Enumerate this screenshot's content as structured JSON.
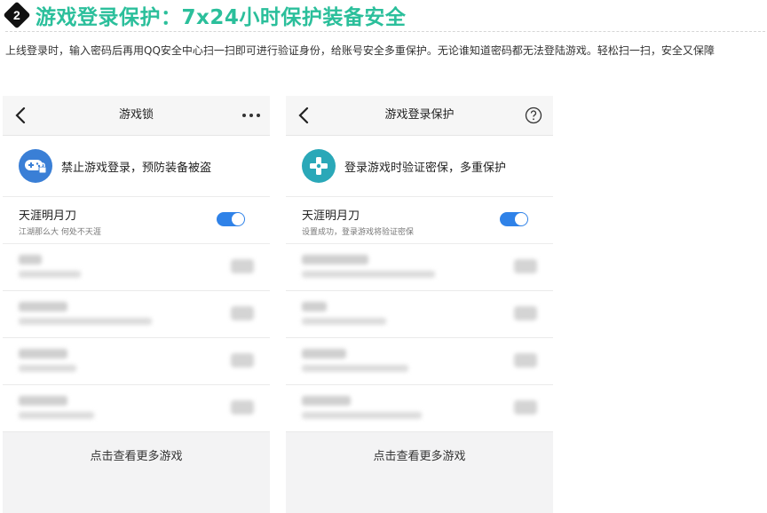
{
  "header": {
    "number": "2",
    "title": "游戏登录保护：7x24小时保护装备安全",
    "description": "上线登录时，输入密码后再用QQ安全中心扫一扫即可进行验证身份，给账号安全多重保护。无论谁知道密码都无法登陆游戏。轻松扫一扫，安全又保障"
  },
  "phones": [
    {
      "nav_title": "游戏锁",
      "right_icon": "more-icon",
      "banner_icon": "gamepad-lock-icon",
      "banner_color": "#3a7fd6",
      "banner_text": "禁止游戏登录，预防装备被盗",
      "game_name": "天涯明月刀",
      "game_sub": "江湖那么大 何处不天涯",
      "toggle_on": true,
      "footer": "点击查看更多游戏"
    },
    {
      "nav_title": "游戏登录保护",
      "right_icon": "help-icon",
      "banner_icon": "dpad-icon",
      "banner_color": "#2aa8b8",
      "banner_text": "登录游戏时验证密保，多重保护",
      "game_name": "天涯明月刀",
      "game_sub": "设置成功，登录游戏将验证密保",
      "toggle_on": true,
      "footer": "点击查看更多游戏"
    }
  ]
}
